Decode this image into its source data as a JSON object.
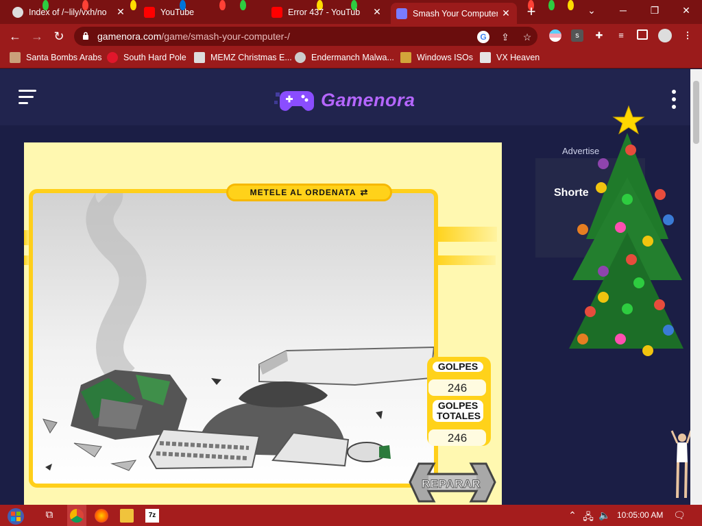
{
  "browser": {
    "tabs": [
      {
        "title": "Index of /~lily/vxh/no",
        "close": "✕",
        "fav_color": "#ffffff"
      },
      {
        "title": "YouTube",
        "close": "",
        "fav_color": "#ff0000"
      },
      {
        "title": "Error 437 - YouTub",
        "close": "✕",
        "fav_color": "#ff0000"
      },
      {
        "title": "Smash Your Computer",
        "close": "✕",
        "fav_color": "#7a7cff"
      }
    ],
    "new_tab": "+",
    "window_controls": {
      "tab_list": "⌄",
      "minimize": "─",
      "restore": "❐",
      "close": "✕"
    },
    "nav": {
      "back": "←",
      "forward": "→",
      "reload": "↻"
    },
    "url_host": "gamenora.com",
    "url_path": "/game/smash-your-computer-/",
    "bookmarks": [
      {
        "label": "Santa Bombs Arabs",
        "color": "#caa07a"
      },
      {
        "label": "South Hard Pole",
        "color": "#e0162b"
      },
      {
        "label": "MEMZ Christmas E...",
        "color": "#dddddd"
      },
      {
        "label": "Endermanch Malwa...",
        "color": "#cccccc"
      },
      {
        "label": "Windows ISOs",
        "color": "#d2a53a"
      },
      {
        "label": "VX Heaven",
        "color": "#e5e5e5"
      }
    ]
  },
  "site": {
    "logo_text": "Gamenora",
    "logo_color": "#b566ff"
  },
  "game": {
    "title": "METELE AL ORDENATA",
    "score_labels": [
      "GOLPES",
      "GOLPES TOTALES"
    ],
    "score_values": [
      "246",
      "246"
    ],
    "repair_label": "REPARAR",
    "accent": "#ffd21a"
  },
  "ad": {
    "label": "Advertise",
    "title": "Shorte"
  },
  "taskbar": {
    "clock": "10:05:00 AM",
    "tray": {
      "chevron": "⌃",
      "network": "🖧",
      "volume": "🔈",
      "notifications": "🗨"
    }
  }
}
